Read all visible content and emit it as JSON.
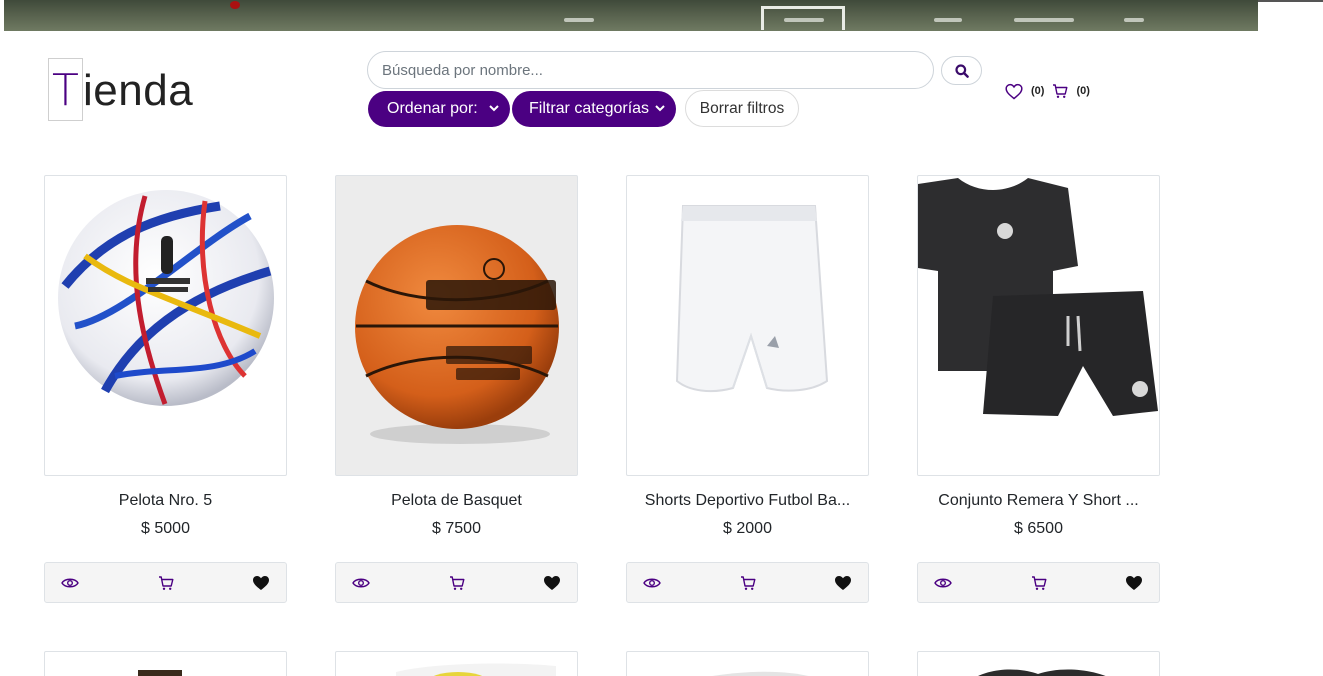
{
  "brand": {
    "first_letter": "T",
    "rest": "ienda"
  },
  "search": {
    "placeholder": "Búsqueda por nombre..."
  },
  "filters": {
    "order_label": "Ordenar por:",
    "category_label": "Filtrar categorías",
    "clear_label": "Borrar filtros"
  },
  "counters": {
    "favorites": "(0)",
    "cart": "(0)"
  },
  "colors": {
    "accent": "#4b0082",
    "action_bar": "#f5f5f5"
  },
  "products": [
    {
      "name": "Pelota Nro. 5",
      "price": "$ 5000"
    },
    {
      "name": "Pelota de Basquet",
      "price": "$ 7500"
    },
    {
      "name": "Shorts Deportivo Futbol Ba...",
      "price": "$ 2000"
    },
    {
      "name": "Conjunto Remera Y Short ...",
      "price": "$ 6500"
    }
  ],
  "icons": {
    "search": "search-icon",
    "favorites": "heart-outline-icon",
    "cart": "cart-icon",
    "view": "eye-icon",
    "add_cart": "cart-icon",
    "favorite": "heart-filled-icon"
  }
}
